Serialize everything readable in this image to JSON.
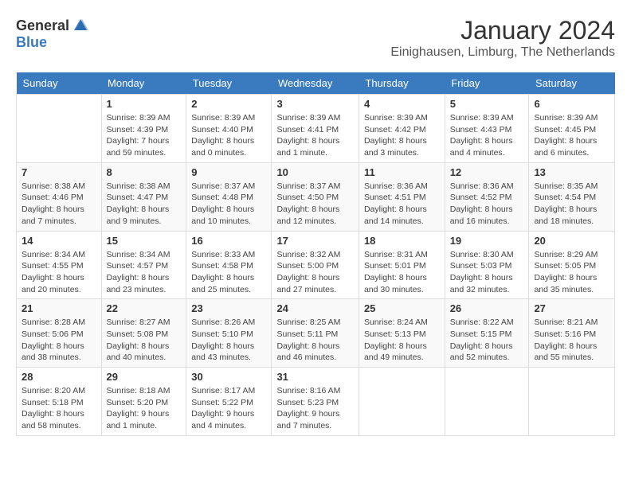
{
  "logo": {
    "text_general": "General",
    "text_blue": "Blue"
  },
  "title": "January 2024",
  "location": "Einighausen, Limburg, The Netherlands",
  "weekdays": [
    "Sunday",
    "Monday",
    "Tuesday",
    "Wednesday",
    "Thursday",
    "Friday",
    "Saturday"
  ],
  "weeks": [
    [
      {
        "day": "",
        "sunrise": "",
        "sunset": "",
        "daylight": ""
      },
      {
        "day": "1",
        "sunrise": "Sunrise: 8:39 AM",
        "sunset": "Sunset: 4:39 PM",
        "daylight": "Daylight: 7 hours and 59 minutes."
      },
      {
        "day": "2",
        "sunrise": "Sunrise: 8:39 AM",
        "sunset": "Sunset: 4:40 PM",
        "daylight": "Daylight: 8 hours and 0 minutes."
      },
      {
        "day": "3",
        "sunrise": "Sunrise: 8:39 AM",
        "sunset": "Sunset: 4:41 PM",
        "daylight": "Daylight: 8 hours and 1 minute."
      },
      {
        "day": "4",
        "sunrise": "Sunrise: 8:39 AM",
        "sunset": "Sunset: 4:42 PM",
        "daylight": "Daylight: 8 hours and 3 minutes."
      },
      {
        "day": "5",
        "sunrise": "Sunrise: 8:39 AM",
        "sunset": "Sunset: 4:43 PM",
        "daylight": "Daylight: 8 hours and 4 minutes."
      },
      {
        "day": "6",
        "sunrise": "Sunrise: 8:39 AM",
        "sunset": "Sunset: 4:45 PM",
        "daylight": "Daylight: 8 hours and 6 minutes."
      }
    ],
    [
      {
        "day": "7",
        "sunrise": "Sunrise: 8:38 AM",
        "sunset": "Sunset: 4:46 PM",
        "daylight": "Daylight: 8 hours and 7 minutes."
      },
      {
        "day": "8",
        "sunrise": "Sunrise: 8:38 AM",
        "sunset": "Sunset: 4:47 PM",
        "daylight": "Daylight: 8 hours and 9 minutes."
      },
      {
        "day": "9",
        "sunrise": "Sunrise: 8:37 AM",
        "sunset": "Sunset: 4:48 PM",
        "daylight": "Daylight: 8 hours and 10 minutes."
      },
      {
        "day": "10",
        "sunrise": "Sunrise: 8:37 AM",
        "sunset": "Sunset: 4:50 PM",
        "daylight": "Daylight: 8 hours and 12 minutes."
      },
      {
        "day": "11",
        "sunrise": "Sunrise: 8:36 AM",
        "sunset": "Sunset: 4:51 PM",
        "daylight": "Daylight: 8 hours and 14 minutes."
      },
      {
        "day": "12",
        "sunrise": "Sunrise: 8:36 AM",
        "sunset": "Sunset: 4:52 PM",
        "daylight": "Daylight: 8 hours and 16 minutes."
      },
      {
        "day": "13",
        "sunrise": "Sunrise: 8:35 AM",
        "sunset": "Sunset: 4:54 PM",
        "daylight": "Daylight: 8 hours and 18 minutes."
      }
    ],
    [
      {
        "day": "14",
        "sunrise": "Sunrise: 8:34 AM",
        "sunset": "Sunset: 4:55 PM",
        "daylight": "Daylight: 8 hours and 20 minutes."
      },
      {
        "day": "15",
        "sunrise": "Sunrise: 8:34 AM",
        "sunset": "Sunset: 4:57 PM",
        "daylight": "Daylight: 8 hours and 23 minutes."
      },
      {
        "day": "16",
        "sunrise": "Sunrise: 8:33 AM",
        "sunset": "Sunset: 4:58 PM",
        "daylight": "Daylight: 8 hours and 25 minutes."
      },
      {
        "day": "17",
        "sunrise": "Sunrise: 8:32 AM",
        "sunset": "Sunset: 5:00 PM",
        "daylight": "Daylight: 8 hours and 27 minutes."
      },
      {
        "day": "18",
        "sunrise": "Sunrise: 8:31 AM",
        "sunset": "Sunset: 5:01 PM",
        "daylight": "Daylight: 8 hours and 30 minutes."
      },
      {
        "day": "19",
        "sunrise": "Sunrise: 8:30 AM",
        "sunset": "Sunset: 5:03 PM",
        "daylight": "Daylight: 8 hours and 32 minutes."
      },
      {
        "day": "20",
        "sunrise": "Sunrise: 8:29 AM",
        "sunset": "Sunset: 5:05 PM",
        "daylight": "Daylight: 8 hours and 35 minutes."
      }
    ],
    [
      {
        "day": "21",
        "sunrise": "Sunrise: 8:28 AM",
        "sunset": "Sunset: 5:06 PM",
        "daylight": "Daylight: 8 hours and 38 minutes."
      },
      {
        "day": "22",
        "sunrise": "Sunrise: 8:27 AM",
        "sunset": "Sunset: 5:08 PM",
        "daylight": "Daylight: 8 hours and 40 minutes."
      },
      {
        "day": "23",
        "sunrise": "Sunrise: 8:26 AM",
        "sunset": "Sunset: 5:10 PM",
        "daylight": "Daylight: 8 hours and 43 minutes."
      },
      {
        "day": "24",
        "sunrise": "Sunrise: 8:25 AM",
        "sunset": "Sunset: 5:11 PM",
        "daylight": "Daylight: 8 hours and 46 minutes."
      },
      {
        "day": "25",
        "sunrise": "Sunrise: 8:24 AM",
        "sunset": "Sunset: 5:13 PM",
        "daylight": "Daylight: 8 hours and 49 minutes."
      },
      {
        "day": "26",
        "sunrise": "Sunrise: 8:22 AM",
        "sunset": "Sunset: 5:15 PM",
        "daylight": "Daylight: 8 hours and 52 minutes."
      },
      {
        "day": "27",
        "sunrise": "Sunrise: 8:21 AM",
        "sunset": "Sunset: 5:16 PM",
        "daylight": "Daylight: 8 hours and 55 minutes."
      }
    ],
    [
      {
        "day": "28",
        "sunrise": "Sunrise: 8:20 AM",
        "sunset": "Sunset: 5:18 PM",
        "daylight": "Daylight: 8 hours and 58 minutes."
      },
      {
        "day": "29",
        "sunrise": "Sunrise: 8:18 AM",
        "sunset": "Sunset: 5:20 PM",
        "daylight": "Daylight: 9 hours and 1 minute."
      },
      {
        "day": "30",
        "sunrise": "Sunrise: 8:17 AM",
        "sunset": "Sunset: 5:22 PM",
        "daylight": "Daylight: 9 hours and 4 minutes."
      },
      {
        "day": "31",
        "sunrise": "Sunrise: 8:16 AM",
        "sunset": "Sunset: 5:23 PM",
        "daylight": "Daylight: 9 hours and 7 minutes."
      },
      {
        "day": "",
        "sunrise": "",
        "sunset": "",
        "daylight": ""
      },
      {
        "day": "",
        "sunrise": "",
        "sunset": "",
        "daylight": ""
      },
      {
        "day": "",
        "sunrise": "",
        "sunset": "",
        "daylight": ""
      }
    ]
  ]
}
